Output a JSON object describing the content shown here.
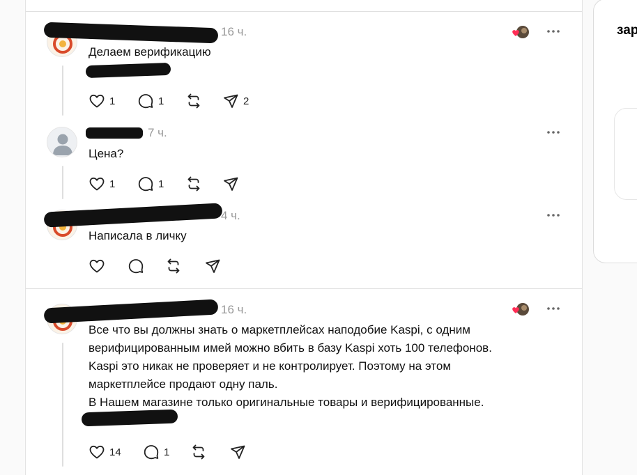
{
  "posts": [
    {
      "time": "16 ч.",
      "text": "Делаем верификацию",
      "counts": {
        "like": "1",
        "reply": "1",
        "share": "2"
      },
      "avatar": "brand-logo"
    },
    {
      "time": "7 ч.",
      "text": "Цена?",
      "counts": {
        "like": "1",
        "reply": "1"
      },
      "avatar": "default-user"
    },
    {
      "time": "4 ч.",
      "text": "Написала в личку",
      "counts": {},
      "avatar": "brand-logo"
    },
    {
      "time": "16 ч.",
      "text_lines": [
        "Все что вы должны знать о маркетплейсах наподобие Kaspi, с одним",
        "верифицированным имей можно вбить в базу Kaspi хоть 100 телефонов.",
        "Kaspi это никак не проверяет и не контролирует. Поэтому на этом",
        "маркетплейсе продают одну паль.",
        "В Нашем магазине только оригинальные товары и верифицированные."
      ],
      "counts": {
        "like": "14",
        "reply": "1"
      },
      "avatar": "brand-logo"
    }
  ],
  "sidebar": {
    "label": "зар"
  },
  "icons": [
    "heart-icon",
    "reply-icon",
    "repost-icon",
    "share-icon",
    "more-icon"
  ],
  "colors": {
    "text": "#111111",
    "muted": "#999999",
    "divider": "#e0e0e0",
    "heart": "#ff2d55"
  }
}
